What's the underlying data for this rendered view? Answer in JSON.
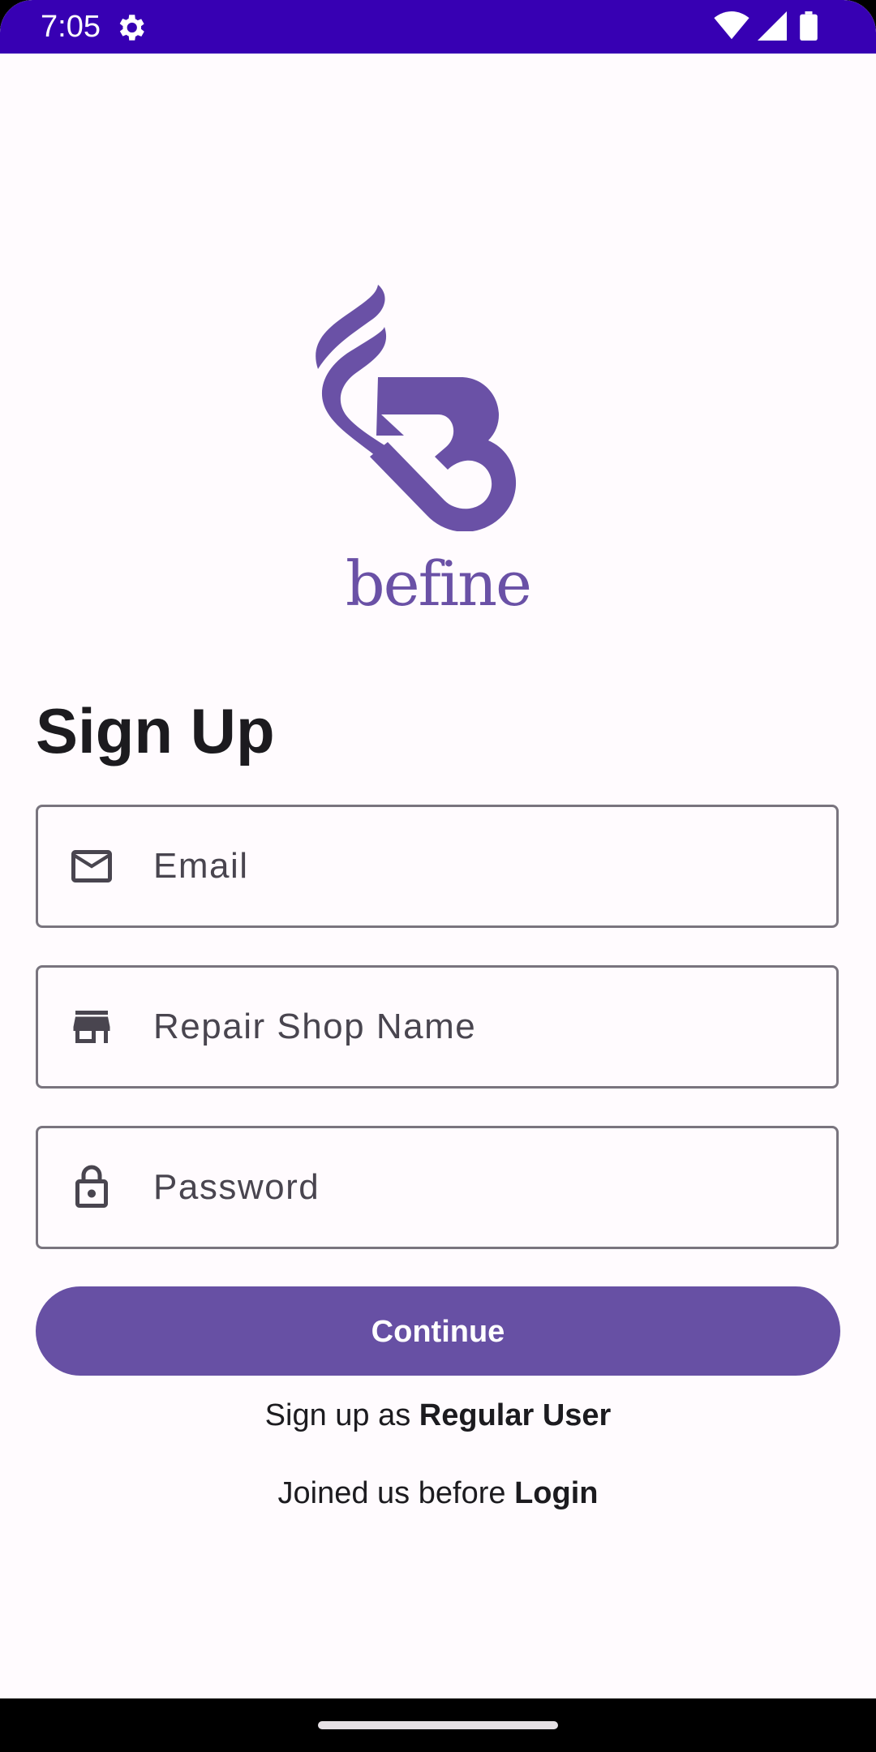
{
  "status_bar": {
    "time": "7:05",
    "icons": [
      "settings-gear-icon",
      "wifi-icon",
      "cell-signal-icon",
      "battery-icon"
    ],
    "background": "#3700B3"
  },
  "brand": {
    "name": "befine",
    "color": "#6A51A6"
  },
  "page": {
    "title": "Sign Up"
  },
  "form": {
    "email": {
      "placeholder": "Email",
      "value": "",
      "icon": "mail-icon"
    },
    "shop_name": {
      "placeholder": "Repair Shop Name",
      "value": "",
      "icon": "store-icon"
    },
    "password": {
      "placeholder": "Password",
      "value": "",
      "icon": "lock-icon"
    },
    "continue_label": "Continue",
    "accent": "#6750A4"
  },
  "links": {
    "signup_prefix": "Sign up as",
    "signup_link": "Regular User",
    "login_prefix": "Joined us before",
    "login_link": "Login"
  }
}
